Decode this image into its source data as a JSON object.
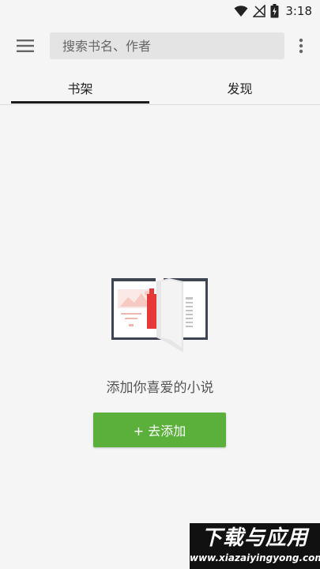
{
  "status_bar": {
    "time": "3:18",
    "icons": [
      "wifi-icon",
      "signal-icon",
      "battery-icon"
    ]
  },
  "toolbar": {
    "menu_icon": "hamburger-menu-icon",
    "search_placeholder": "搜索书名、作者",
    "more_icon": "more-vert-icon"
  },
  "tabs": [
    {
      "label": "书架",
      "selected": true
    },
    {
      "label": "发现",
      "selected": false
    }
  ],
  "empty_state": {
    "illustration": "open-book-icon",
    "message": "添加你喜爱的小说",
    "button_label": "+ 去添加"
  },
  "watermark": {
    "title": "下载与应用",
    "url": "www.xiazaiyingyong.com"
  },
  "colors": {
    "accent": "#5bb03c",
    "background": "#f5f5f5",
    "search_bg": "#e4e4e4",
    "bookmark": "#e53935"
  }
}
